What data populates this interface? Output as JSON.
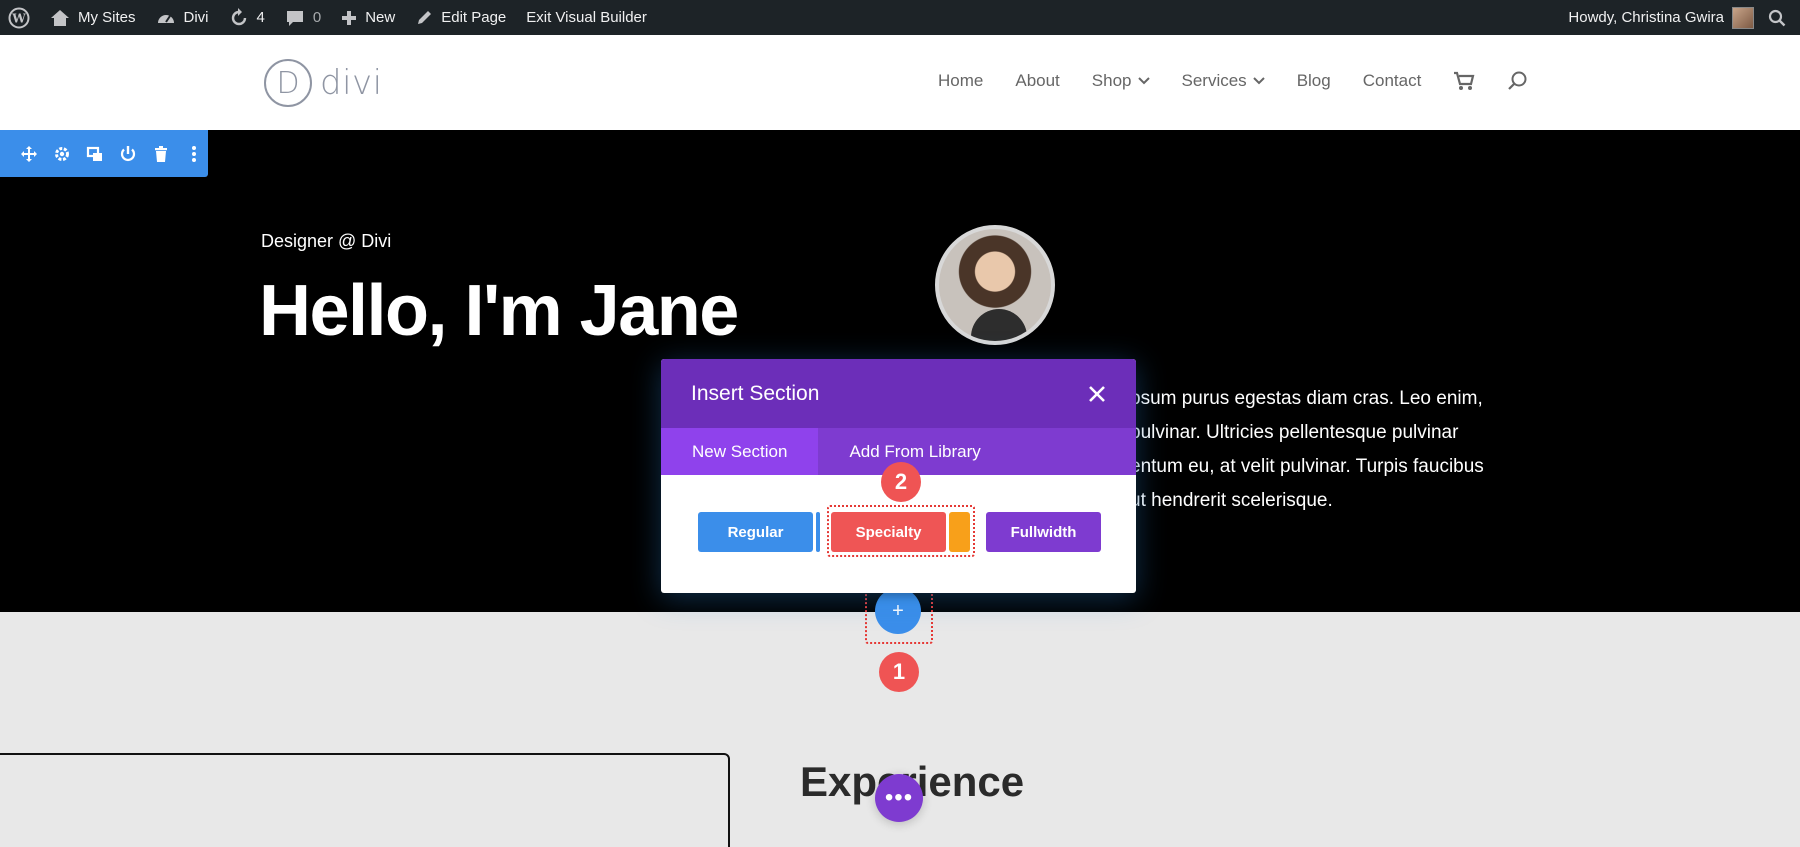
{
  "admin_bar": {
    "my_sites": "My Sites",
    "site_name": "Divi",
    "updates_count": "4",
    "comments_count": "0",
    "new_label": "New",
    "edit_page": "Edit Page",
    "exit_builder": "Exit Visual Builder",
    "howdy": "Howdy, Christina Gwira"
  },
  "header": {
    "logo_letter": "D",
    "logo_text": "divi",
    "nav": [
      {
        "label": "Home"
      },
      {
        "label": "About"
      },
      {
        "label": "Shop",
        "has_dropdown": true
      },
      {
        "label": "Services",
        "has_dropdown": true
      },
      {
        "label": "Blog"
      },
      {
        "label": "Contact"
      }
    ]
  },
  "hero": {
    "subtitle": "Designer @ Divi",
    "title": "Hello, I'm Jane",
    "body_lines": [
      "psum purus egestas diam cras. Leo enim,",
      "pulvinar. Ultricies pellentesque pulvinar",
      "entum eu, at velit pulvinar. Turpis faucibus",
      "ut hendrerit scelerisque."
    ]
  },
  "modal": {
    "title": "Insert Section",
    "tabs": [
      "New Section",
      "Add From Library"
    ],
    "active_tab": "New Section",
    "buttons": {
      "regular": "Regular",
      "specialty": "Specialty",
      "fullwidth": "Fullwidth"
    }
  },
  "markers": {
    "one": "1",
    "two": "2"
  },
  "add_button": "+",
  "lower_section": {
    "title": "Experience",
    "dots": "•••"
  },
  "colors": {
    "admin_bar": "#1d2327",
    "builder_blue": "#3b8eea",
    "modal_purple": "#6c2eb9",
    "tab_purple": "#7e3bd0",
    "specialty_red": "#ef5555",
    "specialty_orange": "#f8a01a",
    "marker_red": "#ef5454"
  }
}
